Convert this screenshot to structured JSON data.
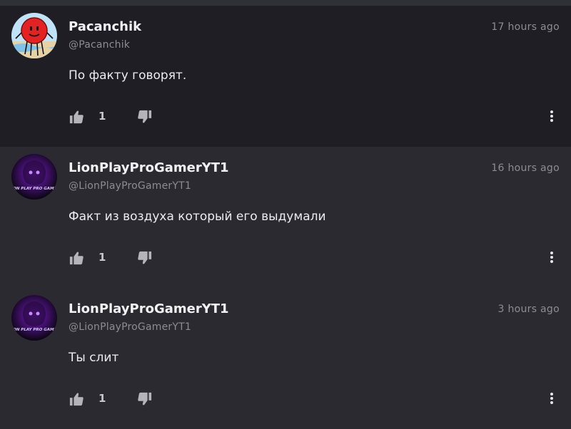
{
  "comments": [
    {
      "author": "Pacanchik",
      "handle": "@Pacanchik",
      "time": "17 hours ago",
      "text": "По факту говорят.",
      "likes": "1",
      "avatar": "red-smiley-avatar"
    },
    {
      "author": "LionPlayProGamerYT1",
      "handle": "@LionPlayProGamerYT1",
      "time": "16 hours ago",
      "text": "Факт из воздуха который его выдумали",
      "likes": "1",
      "avatar": "lion-play-avatar",
      "avatar_text": "LION PLAY PRO GAMER"
    },
    {
      "author": "LionPlayProGamerYT1",
      "handle": "@LionPlayProGamerYT1",
      "time": "3 hours ago",
      "text": "Ты слит",
      "likes": "1",
      "avatar": "lion-play-avatar",
      "avatar_text": "LION PLAY PRO GAMER"
    }
  ],
  "icons": {
    "like": "thumbs-up-icon",
    "dislike": "thumbs-down-icon",
    "more": "more-vertical-icon"
  },
  "colors": {
    "first_comment_bg": "#1f1e24",
    "comment_bg": "#2b2a31",
    "name_color": "#f2f2f4",
    "muted_color": "#8d8c95"
  }
}
